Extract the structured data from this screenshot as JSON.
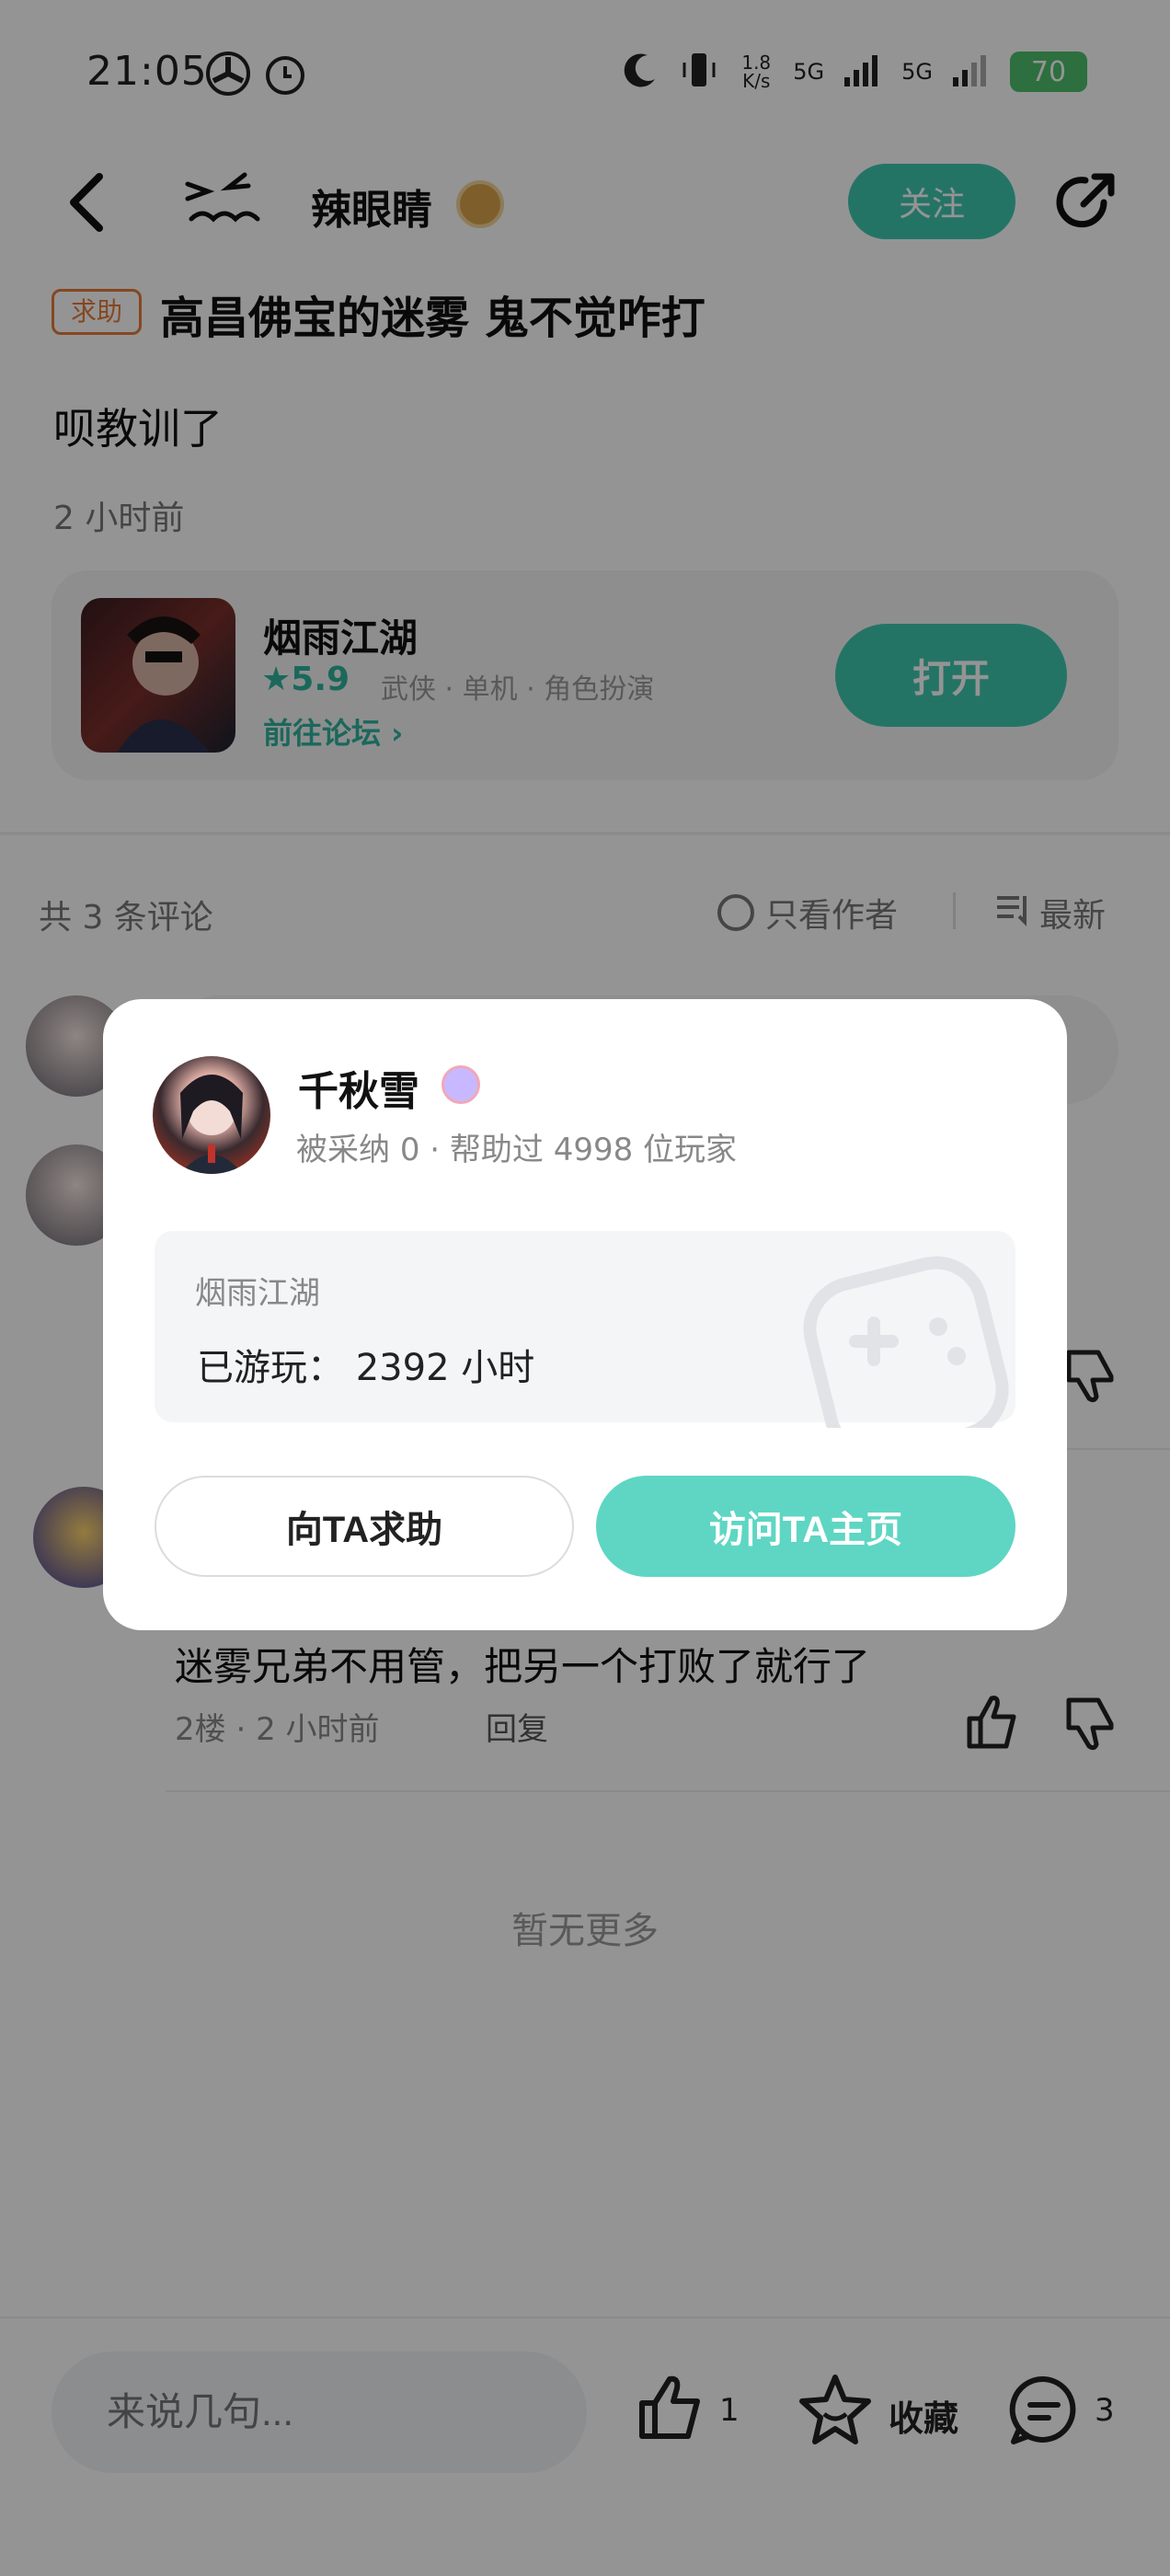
{
  "status_bar": {
    "time": "21:05",
    "net_speed": "1.8 K/s",
    "signal1": "5G",
    "signal2": "5G",
    "battery": "70"
  },
  "header": {
    "username": "辣眼睛",
    "follow_label": "关注"
  },
  "post": {
    "tag": "求助",
    "title": "高昌佛宝的迷雾 鬼不觉咋打",
    "body": "呗教训了",
    "time": "2 小时前"
  },
  "game_card": {
    "name": "烟雨江湖",
    "score": "5.9",
    "tags": "武侠 · 单机 · 角色扮演",
    "forum_link": "前往论坛",
    "open_label": "打开"
  },
  "comments_header": {
    "count_text": "共 3 条评论",
    "only_author": "只看作者",
    "sort": "最新"
  },
  "comment2": {
    "text": "迷雾兄弟不用管，把另一个打败了就行了",
    "floor": "2楼",
    "time": "2 小时前",
    "reply_label": "回复"
  },
  "no_more": "暂无更多",
  "bottom_bar": {
    "input_placeholder": "来说几句...",
    "like_count": "1",
    "fav_label": "收藏",
    "comment_count": "3"
  },
  "modal": {
    "name": "千秋雪",
    "adopted_label": "被采纳",
    "adopted_count": "0",
    "helped_label": "帮助过",
    "helped_count": "4998",
    "helped_suffix": "位玩家",
    "game": "烟雨江湖",
    "played_label": "已游玩：",
    "played_hours": "2392",
    "played_unit": "小时",
    "help_button": "向TA求助",
    "visit_button": "访问TA主页"
  }
}
